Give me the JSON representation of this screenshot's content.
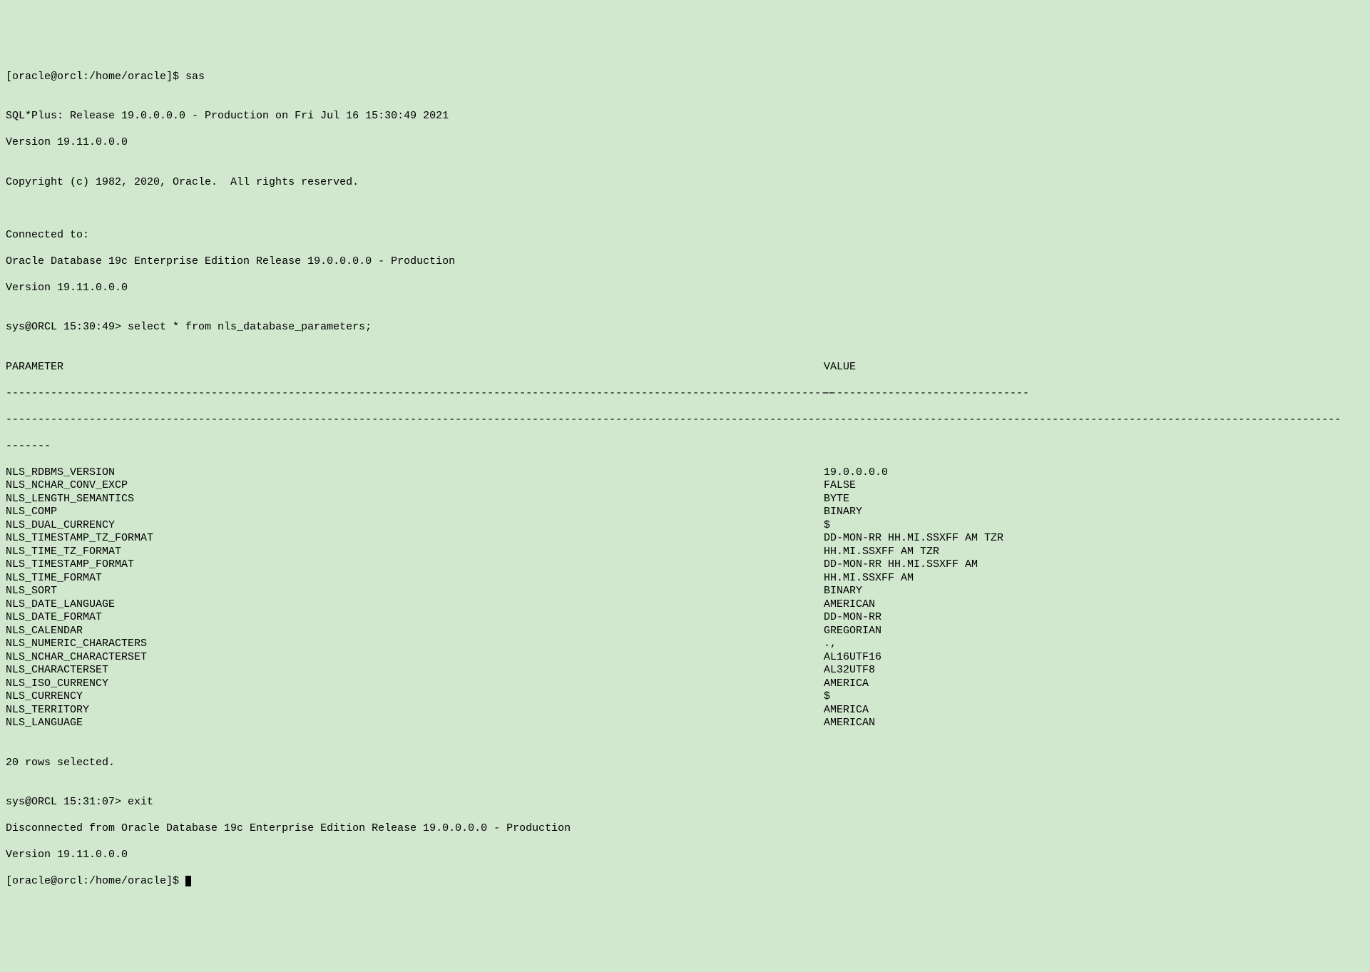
{
  "prompt1": "[oracle@orcl:/home/oracle]$ ",
  "command1": "sas",
  "blank": "",
  "banner1": "SQL*Plus: Release 19.0.0.0.0 - Production on Fri Jul 16 15:30:49 2021",
  "banner2": "Version 19.11.0.0.0",
  "copyright": "Copyright (c) 1982, 2020, Oracle.  All rights reserved.",
  "connected_to": "Connected to:",
  "db_info1": "Oracle Database 19c Enterprise Edition Release 19.0.0.0.0 - Production",
  "db_info2": "Version 19.11.0.0.0",
  "sql_prompt1": "sys@ORCL 15:30:49> ",
  "sql_command1": "select * from nls_database_parameters;",
  "header_parameter": "PARAMETER",
  "header_value": "VALUE",
  "dash_param": "---------------------------------------------------------------------------------------------------------------------------------",
  "dash_value": "--------------------------------",
  "dash_wrap": "----------------------------------------------------------------------------------------------------------------------------------------------------------------------------------------------------------------",
  "dash_wrap2": "-------",
  "rows": [
    {
      "parameter": "NLS_RDBMS_VERSION",
      "value": "19.0.0.0.0"
    },
    {
      "parameter": "NLS_NCHAR_CONV_EXCP",
      "value": "FALSE"
    },
    {
      "parameter": "NLS_LENGTH_SEMANTICS",
      "value": "BYTE"
    },
    {
      "parameter": "NLS_COMP",
      "value": "BINARY"
    },
    {
      "parameter": "NLS_DUAL_CURRENCY",
      "value": "$"
    },
    {
      "parameter": "NLS_TIMESTAMP_TZ_FORMAT",
      "value": "DD-MON-RR HH.MI.SSXFF AM TZR"
    },
    {
      "parameter": "NLS_TIME_TZ_FORMAT",
      "value": "HH.MI.SSXFF AM TZR"
    },
    {
      "parameter": "NLS_TIMESTAMP_FORMAT",
      "value": "DD-MON-RR HH.MI.SSXFF AM"
    },
    {
      "parameter": "NLS_TIME_FORMAT",
      "value": "HH.MI.SSXFF AM"
    },
    {
      "parameter": "NLS_SORT",
      "value": "BINARY"
    },
    {
      "parameter": "NLS_DATE_LANGUAGE",
      "value": "AMERICAN"
    },
    {
      "parameter": "NLS_DATE_FORMAT",
      "value": "DD-MON-RR"
    },
    {
      "parameter": "NLS_CALENDAR",
      "value": "GREGORIAN"
    },
    {
      "parameter": "NLS_NUMERIC_CHARACTERS",
      "value": ".,"
    },
    {
      "parameter": "NLS_NCHAR_CHARACTERSET",
      "value": "AL16UTF16"
    },
    {
      "parameter": "NLS_CHARACTERSET",
      "value": "AL32UTF8"
    },
    {
      "parameter": "NLS_ISO_CURRENCY",
      "value": "AMERICA"
    },
    {
      "parameter": "NLS_CURRENCY",
      "value": "$"
    },
    {
      "parameter": "NLS_TERRITORY",
      "value": "AMERICA"
    },
    {
      "parameter": "NLS_LANGUAGE",
      "value": "AMERICAN"
    }
  ],
  "rows_selected": "20 rows selected.",
  "sql_prompt2": "sys@ORCL 15:31:07> ",
  "sql_command2": "exit",
  "disconnected": "Disconnected from Oracle Database 19c Enterprise Edition Release 19.0.0.0.0 - Production",
  "version_exit": "Version 19.11.0.0.0",
  "prompt2": "[oracle@orcl:/home/oracle]$ "
}
